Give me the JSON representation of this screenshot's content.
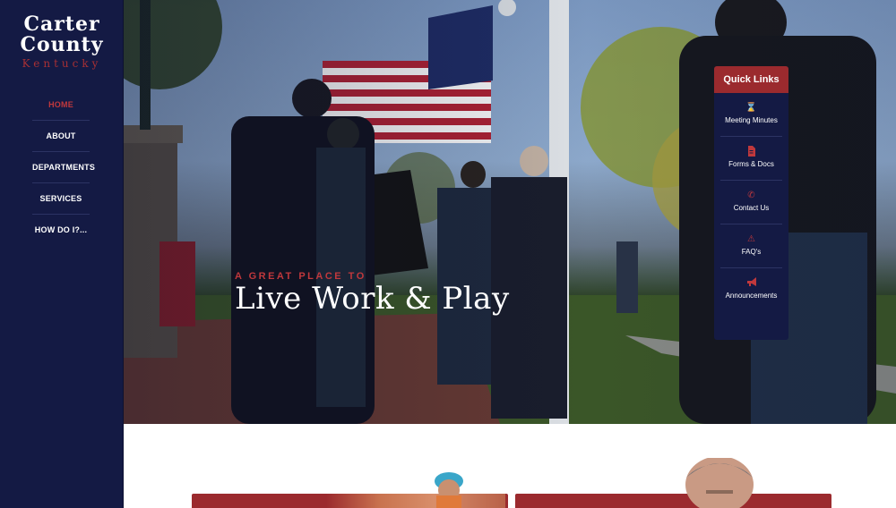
{
  "brand": {
    "line1": "Carter",
    "line2": "County",
    "line3": "Kentucky"
  },
  "nav": {
    "items": [
      {
        "label": "HOME",
        "active": true
      },
      {
        "label": "ABOUT",
        "active": false
      },
      {
        "label": "DEPARTMENTS",
        "active": false
      },
      {
        "label": "SERVICES",
        "active": false
      },
      {
        "label": "HOW DO I?...",
        "active": false
      }
    ]
  },
  "hero": {
    "tagline": "A GREAT PLACE TO",
    "headline": "Live Work & Play"
  },
  "quick_links": {
    "title": "Quick Links",
    "items": [
      {
        "label": "Meeting Minutes",
        "icon": "hourglass-icon"
      },
      {
        "label": "Forms & Docs",
        "icon": "document-icon"
      },
      {
        "label": "Contact Us",
        "icon": "phone-icon"
      },
      {
        "label": "FAQ's",
        "icon": "warning-icon"
      },
      {
        "label": "Announcements",
        "icon": "megaphone-icon"
      }
    ]
  },
  "colors": {
    "navy": "#141a44",
    "accent_red": "#9b2a2e",
    "active_red": "#c0383c"
  }
}
